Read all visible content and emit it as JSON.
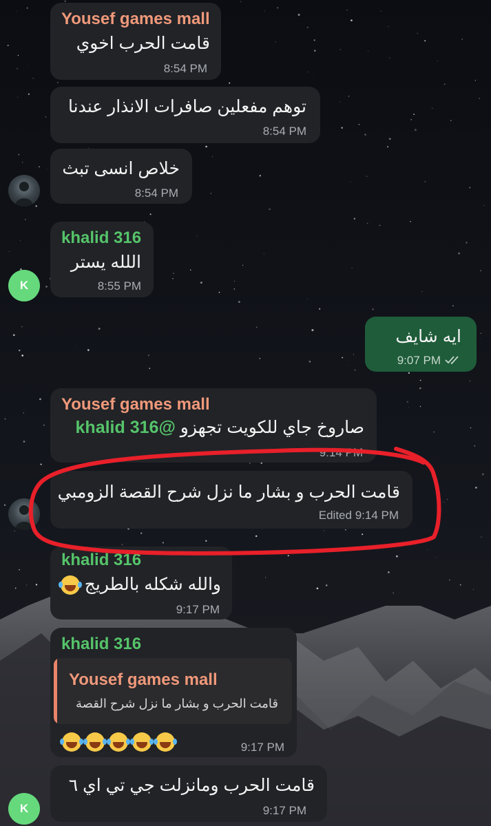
{
  "colors": {
    "bubble_in": "#212327",
    "bubble_out": "#1f5c3a",
    "sender_yousef": "#f0997a",
    "sender_khalid": "#56c46a",
    "avatar_green": "#66d97c",
    "annotation_red": "#e8202a"
  },
  "messages": [
    {
      "sender": "Yousef games mall",
      "text": "قامت الحرب اخوي",
      "time": "8:54 PM"
    },
    {
      "text": "توهم مفعلين صافرات الانذار عندنا",
      "time": "8:54 PM"
    },
    {
      "text": "خلاص انسى تبث",
      "time": "8:54 PM"
    },
    {
      "sender": "khalid 316",
      "text": "اللله يستر",
      "time": "8:55 PM"
    },
    {
      "text": "ايه شايف",
      "time": "9:07 PM",
      "outgoing": true,
      "status_icon": "double-check-icon"
    },
    {
      "sender": "Yousef games mall",
      "mention": "@khalid 316",
      "text": "صاروخ جاي للكويت تجهزو",
      "time": "9:14 PM"
    },
    {
      "text": "قامت الحرب و بشار ما نزل شرح القصة الزومبي",
      "edited_label": "Edited",
      "time": "9:14 PM"
    },
    {
      "sender": "khalid 316",
      "text": "والله شكله بالطريج",
      "emoji": "face-with-tears-of-joy",
      "time": "9:17 PM"
    },
    {
      "sender": "khalid 316",
      "reply_sender": "Yousef games mall",
      "reply_text": "قامت الحرب و بشار ما نزل شرح القصة",
      "emoji_count": 5,
      "time": "9:17 PM"
    },
    {
      "text": "قامت الحرب ومانزلت جي تي اي ٦",
      "time": "9:17 PM"
    }
  ],
  "avatars": {
    "khalid_letter": "K",
    "yousef_icon": "profile-photo-icon"
  }
}
